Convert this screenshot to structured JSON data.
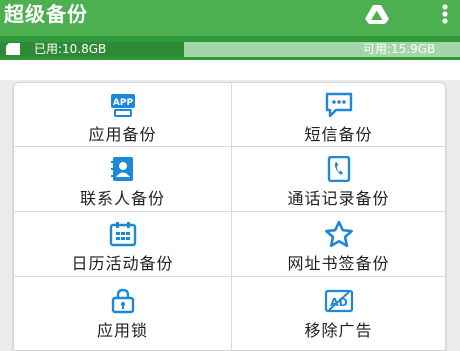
{
  "app": {
    "title": "超级备份"
  },
  "storage": {
    "used_label": "已用:10.8GB",
    "free_label": "可用:15.9GB",
    "used_fraction": 0.4
  },
  "colors": {
    "appbar": "#4caf50",
    "storage_bar": "#2e8a35",
    "storage_track": "#a5d6a7",
    "icon_blue": "#1e88d8"
  },
  "menu": {
    "items": [
      {
        "label": "应用备份",
        "icon": "app-icon"
      },
      {
        "label": "短信备份",
        "icon": "message-icon"
      },
      {
        "label": "联系人备份",
        "icon": "contacts-icon"
      },
      {
        "label": "通话记录备份",
        "icon": "phone-icon"
      },
      {
        "label": "日历活动备份",
        "icon": "calendar-icon"
      },
      {
        "label": "网址书签备份",
        "icon": "star-icon"
      },
      {
        "label": "应用锁",
        "icon": "lock-icon"
      },
      {
        "label": "移除广告",
        "icon": "ad-block-icon"
      }
    ]
  }
}
